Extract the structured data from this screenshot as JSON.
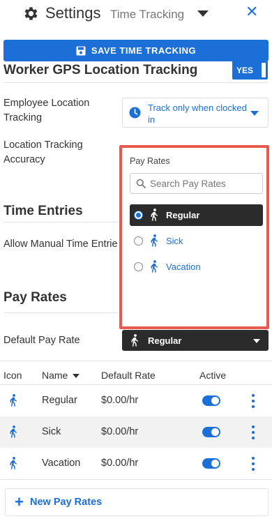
{
  "header": {
    "title": "Settings",
    "subtitle": "Time Tracking",
    "close_icon": "close-icon"
  },
  "save_button": {
    "label": "SAVE TIME TRACKING"
  },
  "gps_section": {
    "title": "Worker GPS Location Tracking",
    "toggle_label": "YES",
    "employee_location_label": "Employee Location Tracking",
    "employee_location_value_line1": "Track only when clocked",
    "employee_location_value_line2": "in",
    "accuracy_label": "Location Tracking Accuracy"
  },
  "time_entries": {
    "title": "Time Entries",
    "manual_label": "Allow Manual Time Entrie"
  },
  "pay_rates_popup": {
    "title": "Pay Rates",
    "search_placeholder": "Search Pay Rates",
    "options": [
      {
        "label": "Regular",
        "selected": true
      },
      {
        "label": "Sick",
        "selected": false
      },
      {
        "label": "Vacation",
        "selected": false
      }
    ]
  },
  "pay_rates": {
    "title": "Pay Rates",
    "default_label": "Default Pay Rate",
    "default_value": "Regular",
    "columns": {
      "icon": "Icon",
      "name": "Name",
      "default_rate": "Default Rate",
      "active": "Active"
    },
    "rows": [
      {
        "name": "Regular",
        "rate": "$0.00/hr",
        "active": true
      },
      {
        "name": "Sick",
        "rate": "$0.00/hr",
        "active": true
      },
      {
        "name": "Vacation",
        "rate": "$0.00/hr",
        "active": true
      }
    ],
    "new_button_label": "New Pay Rates"
  },
  "colors": {
    "accent": "#1b6fd6",
    "highlight_border": "#e85a4f",
    "dark_select": "#2b2b2b"
  }
}
